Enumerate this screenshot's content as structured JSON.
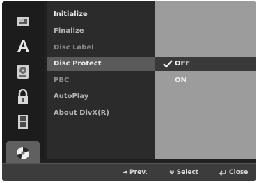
{
  "menu": {
    "items": [
      {
        "label": "Initialize"
      },
      {
        "label": "Finalize"
      },
      {
        "label": "Disc Label"
      },
      {
        "label": "Disc Protect"
      },
      {
        "label": "PBC"
      },
      {
        "label": "AutoPlay"
      },
      {
        "label": "About DivX(R)"
      }
    ],
    "selected_index": 3
  },
  "options": {
    "items": [
      {
        "label": "OFF",
        "checked": true
      },
      {
        "label": "ON",
        "checked": false
      }
    ]
  },
  "sidebar": {
    "icons": [
      "film-icon",
      "letter-a-icon",
      "disc-box-icon",
      "padlock-icon",
      "film-strip-icon",
      "disc-icon"
    ],
    "selected_icon": "disc-icon"
  },
  "footer": {
    "prev_label": "◄ Prev.",
    "select_label": "⊙ Select",
    "close_label": "Close",
    "close_icon": "return-arrow-icon"
  }
}
